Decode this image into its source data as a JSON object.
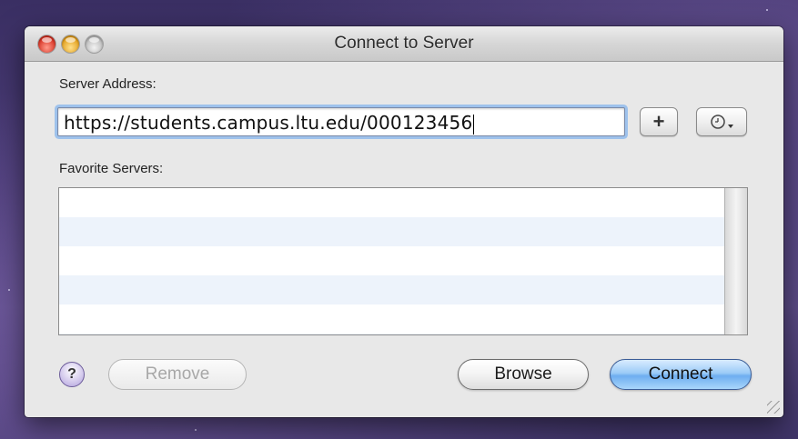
{
  "window": {
    "title": "Connect to Server"
  },
  "server_address": {
    "label": "Server Address:",
    "value": "https://students.campus.ltu.edu/000123456"
  },
  "buttons": {
    "add": "+",
    "recent_icon": "clock-icon",
    "help": "?",
    "remove": "Remove",
    "browse": "Browse",
    "connect": "Connect"
  },
  "favorites": {
    "label": "Favorite Servers:",
    "items": []
  },
  "colors": {
    "focus_ring": "#9ec2ec",
    "row_stripe": "#edf3fb",
    "default_button": "#6eaef0",
    "close_button": "#d42b1c",
    "minimize_button": "#e09a15"
  }
}
